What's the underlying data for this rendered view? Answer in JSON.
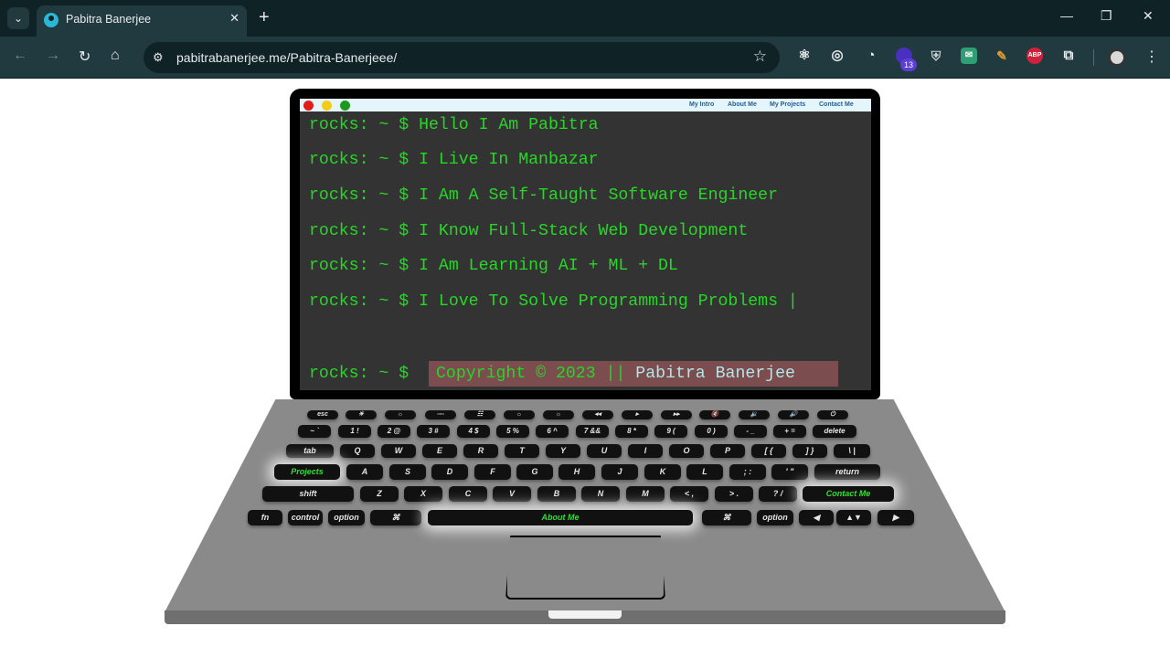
{
  "browser": {
    "tab_title": "Pabitra Banerjee",
    "url": "pabitrabanerjee.me/Pabitra-Banerjeee/",
    "extension_badge": "13",
    "abp_label": "ABP"
  },
  "site": {
    "nav": [
      "My Intro",
      "About Me",
      "My Projects",
      "Contact Me"
    ],
    "prompt": "rocks: ~ $",
    "terminal_lines": [
      "I Am A Self-Taught Software Engineer",
      "I Know Full-Stack Web Development",
      "I Am Learning AI + ML + DL"
    ],
    "line_1_text": "Hello I Am Pabitra",
    "line_2_text": "I Live In Manbazar",
    "typing_line": "I Love To Solve Programming Problems",
    "cursor": "|",
    "copyright_prefix": "Copyright © 2023 || ",
    "copyright_name": "Pabitra Banerjee"
  },
  "keyboard": {
    "row1": [
      "esc",
      "☀",
      "☼",
      "▫▫▫",
      "☷",
      "☼",
      "☼",
      "◂◂",
      "▸",
      "▸▸",
      "🔇",
      "🔉",
      "🔊",
      "⏻"
    ],
    "row2": [
      "~ `",
      "1 !",
      "2 @",
      "3 #",
      "4 $",
      "5 %",
      "6 ^",
      "7 &&",
      "8 *",
      "9 (",
      "0 )",
      "- _",
      "+ =",
      "delete"
    ],
    "row3": [
      "tab",
      "Q",
      "W",
      "E",
      "R",
      "T",
      "Y",
      "U",
      "I",
      "O",
      "P",
      "[ {",
      "] }",
      "\\ |"
    ],
    "row4": [
      "Projects",
      "A",
      "S",
      "D",
      "F",
      "G",
      "H",
      "J",
      "K",
      "L",
      "; :",
      "' \"",
      "return"
    ],
    "row5": [
      "shift",
      "Z",
      "X",
      "C",
      "V",
      "B",
      "N",
      "M",
      "< ,",
      "> .",
      "? /",
      "Contact Me"
    ],
    "row6": [
      "fn",
      "control",
      "option",
      "⌘",
      "About Me",
      "⌘",
      "option",
      "◀",
      "▲▼",
      "▶"
    ]
  },
  "colors": {
    "terminal_green": "#28d628",
    "terminal_bg": "#333333",
    "copyright_bg": "#7b4d4f",
    "laptop_body": "#8a8a8a"
  }
}
